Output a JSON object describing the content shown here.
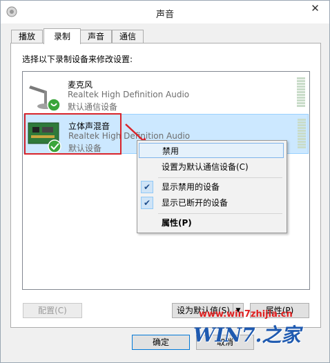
{
  "window": {
    "title": "声音",
    "close_glyph": "✕"
  },
  "tabs": [
    {
      "label": "播放"
    },
    {
      "label": "录制"
    },
    {
      "label": "声音"
    },
    {
      "label": "通信"
    }
  ],
  "active_tab": "录制",
  "panel": {
    "instruction": "选择以下录制设备来修改设置:"
  },
  "devices": [
    {
      "name": "麦克风",
      "driver": "Realtek High Definition Audio",
      "status": "默认通信设备",
      "icon": "microphone-icon",
      "badge": "phone-badge-icon"
    },
    {
      "name": "立体声混音",
      "driver": "Realtek High Definition Audio",
      "status": "默认设备",
      "icon": "sound-card-icon",
      "badge": "check-badge-icon",
      "selected": true
    }
  ],
  "buttons": {
    "configure": "配置(C)",
    "set_default": "设为默认值(S)",
    "properties": "属性(P)",
    "ok": "确定",
    "cancel": "取消"
  },
  "context_menu": {
    "items": [
      {
        "label": "禁用",
        "highlighted": true
      },
      {
        "label": "设置为默认通信设备(C)"
      },
      {
        "label": "显示禁用的设备",
        "checked": true
      },
      {
        "label": "显示已断开的设备",
        "checked": true
      },
      {
        "label": "属性(P)",
        "bold": true
      }
    ]
  },
  "watermark": {
    "url": "www.win7zhijia.cn",
    "logo": "WIN7.之家"
  },
  "colors": {
    "annotation_red": "#d9232a",
    "selection_blue": "#cce8ff"
  }
}
